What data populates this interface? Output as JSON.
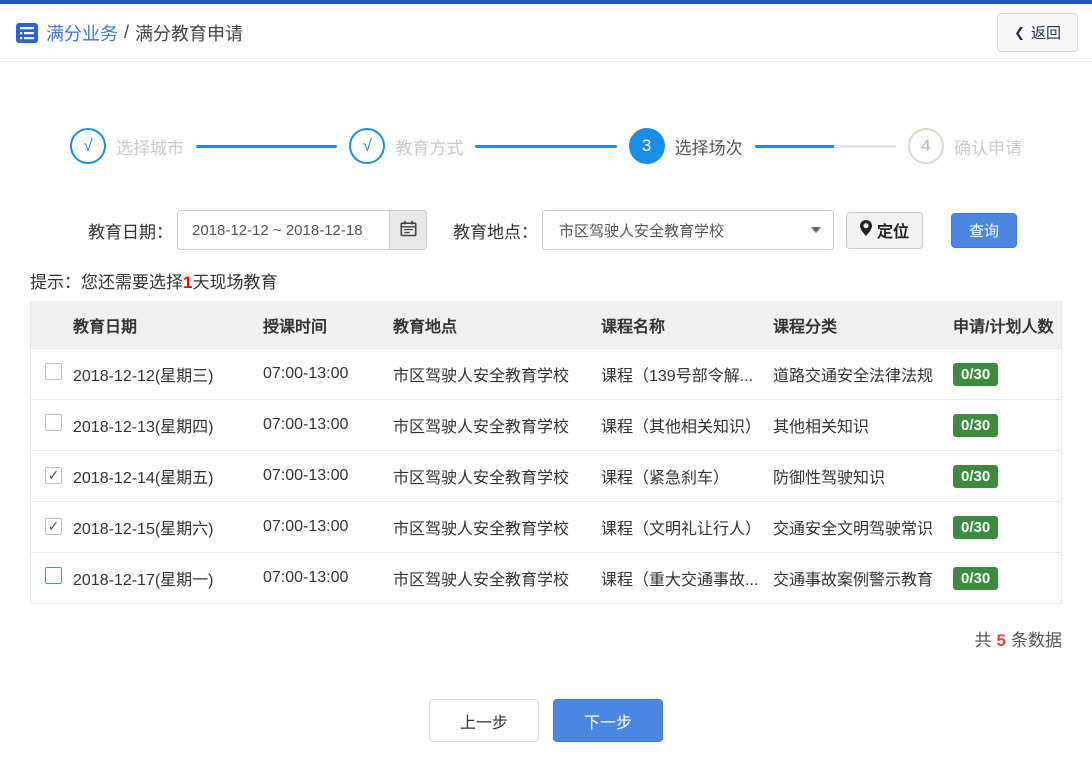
{
  "header": {
    "section": "满分业务",
    "separator": "/",
    "page": "满分教育申请",
    "back_chevron": "❮",
    "back_label": "返回"
  },
  "steps": [
    {
      "symbol": "√",
      "label": "选择城市",
      "state": "done"
    },
    {
      "symbol": "√",
      "label": "教育方式",
      "state": "done"
    },
    {
      "symbol": "3",
      "label": "选择场次",
      "state": "current"
    },
    {
      "symbol": "4",
      "label": "确认申请",
      "state": "pending"
    }
  ],
  "filters": {
    "date_label": "教育日期：",
    "date_value": "2018-12-12 ~ 2018-12-18",
    "location_label": "教育地点：",
    "location_value": "市区驾驶人安全教育学校",
    "locate_label": "定位",
    "search_label": "查询"
  },
  "hint": {
    "prefix": "提示：您还需要选择",
    "highlight": "1",
    "suffix": "天现场教育"
  },
  "table": {
    "columns": [
      "教育日期",
      "授课时间",
      "教育地点",
      "课程名称",
      "课程分类",
      "申请/计划人数"
    ],
    "rows": [
      {
        "checked": false,
        "focus": false,
        "date": "2018-12-12(星期三)",
        "time": "07:00-13:00",
        "location": "市区驾驶人安全教育学校",
        "course": "课程（139号部令解...",
        "category": "道路交通安全法律法规",
        "count": "0/30"
      },
      {
        "checked": false,
        "focus": false,
        "date": "2018-12-13(星期四)",
        "time": "07:00-13:00",
        "location": "市区驾驶人安全教育学校",
        "course": "课程（其他相关知识）",
        "category": "其他相关知识",
        "count": "0/30"
      },
      {
        "checked": true,
        "focus": false,
        "date": "2018-12-14(星期五)",
        "time": "07:00-13:00",
        "location": "市区驾驶人安全教育学校",
        "course": "课程（紧急刹车）",
        "category": "防御性驾驶知识",
        "count": "0/30"
      },
      {
        "checked": true,
        "focus": false,
        "date": "2018-12-15(星期六)",
        "time": "07:00-13:00",
        "location": "市区驾驶人安全教育学校",
        "course": "课程（文明礼让行人）",
        "category": "交通安全文明驾驶常识",
        "count": "0/30"
      },
      {
        "checked": false,
        "focus": true,
        "date": "2018-12-17(星期一)",
        "time": "07:00-13:00",
        "location": "市区驾驶人安全教育学校",
        "course": "课程（重大交通事故...",
        "category": "交通事故案例警示教育",
        "count": "0/30"
      }
    ]
  },
  "summary": {
    "prefix": "共",
    "count": "5",
    "suffix": "条数据"
  },
  "footer": {
    "prev_label": "上一步",
    "next_label": "下一步"
  },
  "icons": {
    "check_glyph": "✓",
    "list_icon": "list-icon",
    "chevron_left": "chevron-left-icon",
    "calendar": "calendar-icon",
    "dropdown_arrow": "chevron-down-icon",
    "location_pin": "location-pin-icon"
  },
  "colors": {
    "top_bar_blue": "#1e57b5",
    "brand_blue": "#4176d2",
    "step_blue": "#1a8de4",
    "button_blue": "#4a87e2",
    "badge_green": "#3c8b40",
    "highlight_red": "#ff0000",
    "count_red": "#e64545"
  }
}
